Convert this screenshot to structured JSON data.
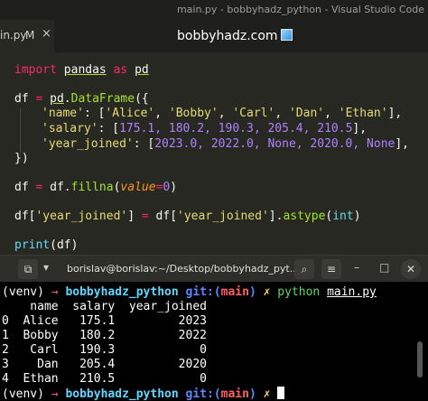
{
  "window": {
    "title": "main.py - bobbyhadz_python - Visual Studio Code"
  },
  "tab": {
    "name": "in.py",
    "modified": "M",
    "close": "×"
  },
  "watermark": {
    "text": "bobbyhadz.com"
  },
  "code": {
    "l1_kw": "import",
    "l1_mod": "pandas",
    "l1_as": "as",
    "l1_alias": "pd",
    "l2_var": "df",
    "l2_eq": "=",
    "l2_mod": "pd",
    "l2_dot": ".",
    "l2_cls": "DataFrame",
    "l2_open": "({",
    "l3_key": "'name'",
    "l3_rest_a": ": [",
    "l3_v1": "'Alice'",
    "l3_v2": "'Bobby'",
    "l3_v3": "'Carl'",
    "l3_v4": "'Dan'",
    "l3_v5": "'Ethan'",
    "l3_close": "],",
    "l4_key": "'salary'",
    "l4_rest_a": ": [",
    "l4_values": "175.1, 180.2, 190.3, 205.4, 210.5",
    "l4_close": "],",
    "l5_key": "'year_joined'",
    "l5_rest_a": ": [",
    "l5_values": "2023.0, 2022.0, None, 2020.0, None",
    "l5_close": "],",
    "l6": "})",
    "l7_var": "df",
    "l7_eq": "=",
    "l7_obj": "df",
    "l7_fn": "fillna",
    "l7_param": "value",
    "l7_val": "0",
    "l8_obj": "df",
    "l8_key": "'year_joined'",
    "l8_eq": "=",
    "l8_obj2": "df",
    "l8_key2": "'year_joined'",
    "l8_fn": "astype",
    "l8_arg": "int",
    "l9_fn": "print",
    "l9_arg": "df"
  },
  "terminal_bar": {
    "title": "borislav@borislav:~/Desktop/bobbyhadz_pyt..."
  },
  "terminal": {
    "venv": "(venv)",
    "arrow": "→",
    "dir": "bobbyhadz_python",
    "git": "git:(",
    "branch": "main",
    "git_close": ")",
    "x": "✗",
    "cmd": "python",
    "file": "main.py",
    "header": "    name  salary  year_joined",
    "rows": [
      "0  Alice   175.1         2023",
      "1  Bobby   180.2         2022",
      "2   Carl   190.3            0",
      "3    Dan   205.4         2020",
      "4  Ethan   210.5            0"
    ]
  }
}
